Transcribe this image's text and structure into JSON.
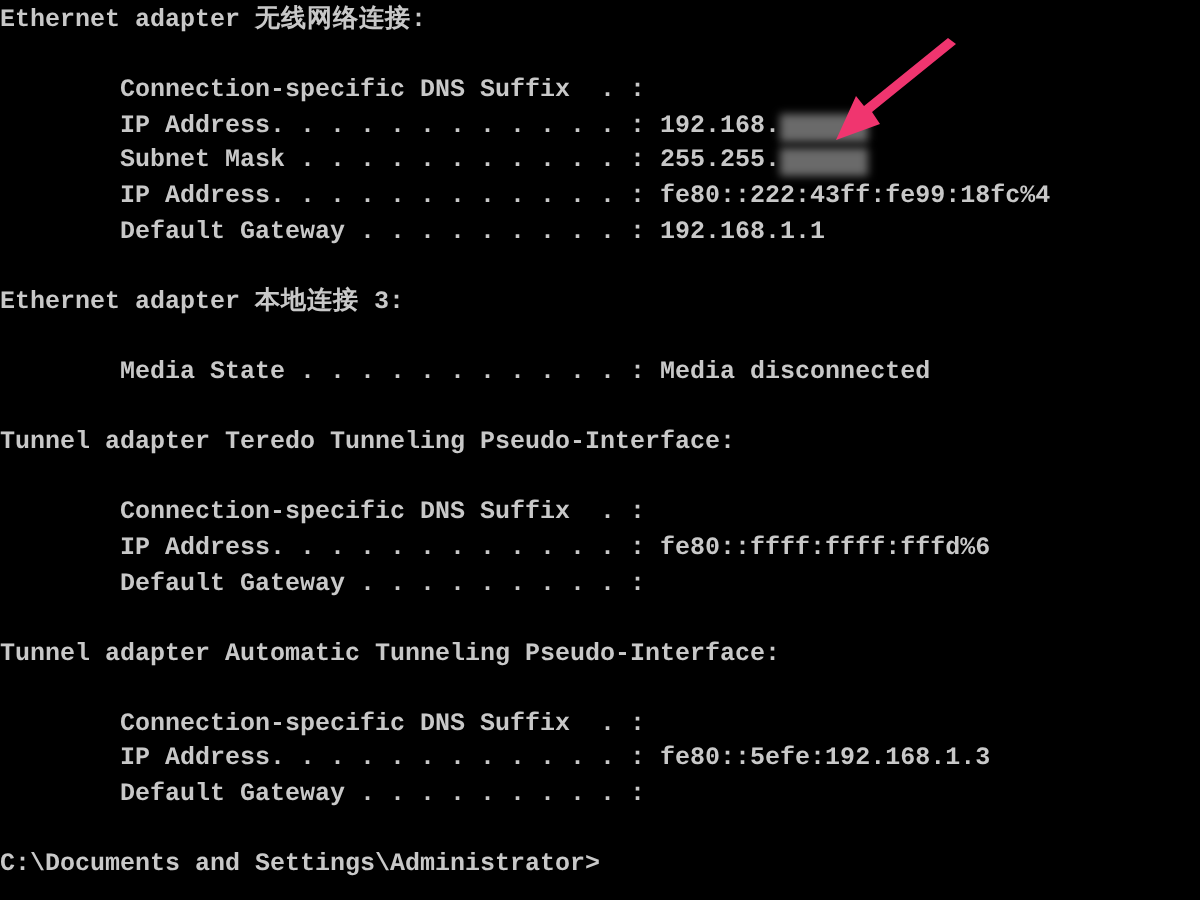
{
  "sections": [
    {
      "heading": "Ethernet adapter 无线网络连接:",
      "entries": [
        {
          "label": "Connection-specific DNS Suffix  . :",
          "redacted": false
        },
        {
          "label": "IP Address. . . . . . . . . . . . :",
          "value": "192.168.",
          "redacted": true
        },
        {
          "label": "Subnet Mask . . . . . . . . . . . :",
          "value": "255.255.",
          "redacted": true
        },
        {
          "label": "IP Address. . . . . . . . . . . . :",
          "value": "fe80::222:43ff:fe99:18fc%4",
          "redacted": false
        },
        {
          "label": "Default Gateway . . . . . . . . . :",
          "value": "192.168.1.1",
          "redacted": false
        }
      ]
    },
    {
      "heading": "Ethernet adapter 本地连接 3:",
      "entries": [
        {
          "label": "Media State . . . . . . . . . . . :",
          "value": "Media disconnected",
          "redacted": false
        }
      ]
    },
    {
      "heading": "Tunnel adapter Teredo Tunneling Pseudo-Interface:",
      "entries": [
        {
          "label": "Connection-specific DNS Suffix  . :",
          "redacted": false
        },
        {
          "label": "IP Address. . . . . . . . . . . . :",
          "value": "fe80::ffff:ffff:fffd%6",
          "redacted": false
        },
        {
          "label": "Default Gateway . . . . . . . . . :",
          "redacted": false
        }
      ]
    },
    {
      "heading": "Tunnel adapter Automatic Tunneling Pseudo-Interface:",
      "entries": [
        {
          "label": "Connection-specific DNS Suffix  . :",
          "redacted": false
        },
        {
          "label": "IP Address. . . . . . . . . . . . :",
          "value": "fe80::5efe:192.168.1.3",
          "redacted": false
        },
        {
          "label": "Default Gateway . . . . . . . . . :",
          "redacted": false
        }
      ]
    }
  ],
  "prompt": "C:\\Documents and Settings\\Administrator>"
}
